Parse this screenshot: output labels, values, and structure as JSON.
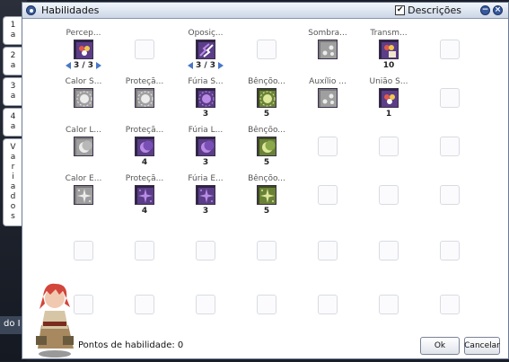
{
  "background_text": "do I",
  "tabs": [
    "1a",
    "2a",
    "3a",
    "4a",
    "Variados"
  ],
  "window": {
    "title": "Habilidades",
    "descriptions_label": "Descrições",
    "descriptions_checked": true
  },
  "colors": {
    "accent": "#355a9e",
    "arrow": "#4a78c8"
  },
  "skills": [
    {
      "row": 0,
      "col": 0,
      "name": "Percep...",
      "level": "3 / 3",
      "arrows": true,
      "icon": "perception-icon",
      "theme": "violet"
    },
    {
      "row": 0,
      "col": 1
    },
    {
      "row": 0,
      "col": 2,
      "name": "Oposiç...",
      "level": "3 / 3",
      "arrows": true,
      "icon": "opposition-icon",
      "theme": "violet"
    },
    {
      "row": 0,
      "col": 3
    },
    {
      "row": 0,
      "col": 4,
      "name": "Sombra...",
      "icon": "shadow-icon",
      "theme": "gray"
    },
    {
      "row": 0,
      "col": 5,
      "name": "Transm...",
      "level": "10",
      "icon": "transmission-icon",
      "theme": "violet"
    },
    {
      "row": 0,
      "col": 6
    },
    {
      "row": 1,
      "col": 0,
      "name": "Calor S...",
      "icon": "sun-heat-icon",
      "theme": "gray"
    },
    {
      "row": 1,
      "col": 1,
      "name": "Proteçã...",
      "icon": "sun-protection-icon",
      "theme": "gray"
    },
    {
      "row": 1,
      "col": 2,
      "name": "Fúria S...",
      "level": "3",
      "icon": "sun-fury-icon",
      "theme": "violet"
    },
    {
      "row": 1,
      "col": 3,
      "name": "Bênçõo...",
      "level": "5",
      "icon": "sun-blessing-icon",
      "theme": "green"
    },
    {
      "row": 1,
      "col": 4,
      "name": "Auxílio ...",
      "icon": "aid-icon",
      "theme": "gray"
    },
    {
      "row": 1,
      "col": 5,
      "name": "União S...",
      "level": "1",
      "icon": "union-icon",
      "theme": "violet"
    },
    {
      "row": 1,
      "col": 6
    },
    {
      "row": 2,
      "col": 0,
      "name": "Calor L...",
      "icon": "moon-heat-icon",
      "theme": "gray"
    },
    {
      "row": 2,
      "col": 1,
      "name": "Proteçã...",
      "level": "4",
      "icon": "moon-protection-icon",
      "theme": "violet"
    },
    {
      "row": 2,
      "col": 2,
      "name": "Fúria L...",
      "level": "3",
      "icon": "moon-fury-icon",
      "theme": "violet"
    },
    {
      "row": 2,
      "col": 3,
      "name": "Bênçõo...",
      "level": "5",
      "icon": "moon-blessing-icon",
      "theme": "green"
    },
    {
      "row": 2,
      "col": 4
    },
    {
      "row": 2,
      "col": 5
    },
    {
      "row": 2,
      "col": 6
    },
    {
      "row": 3,
      "col": 0,
      "name": "Calor E...",
      "icon": "star-heat-icon",
      "theme": "gray"
    },
    {
      "row": 3,
      "col": 1,
      "name": "Proteçã...",
      "level": "4",
      "icon": "star-protection-icon",
      "theme": "violet"
    },
    {
      "row": 3,
      "col": 2,
      "name": "Fúria E...",
      "level": "3",
      "icon": "star-fury-icon",
      "theme": "violet"
    },
    {
      "row": 3,
      "col": 3,
      "name": "Bênçõo...",
      "level": "5",
      "icon": "star-blessing-icon",
      "theme": "green"
    },
    {
      "row": 3,
      "col": 4
    },
    {
      "row": 3,
      "col": 5
    },
    {
      "row": 3,
      "col": 6
    },
    {
      "row": 4,
      "col": 0
    },
    {
      "row": 4,
      "col": 1
    },
    {
      "row": 4,
      "col": 2
    },
    {
      "row": 4,
      "col": 3
    },
    {
      "row": 4,
      "col": 4
    },
    {
      "row": 4,
      "col": 5
    },
    {
      "row": 4,
      "col": 6
    },
    {
      "row": 5,
      "col": 0
    },
    {
      "row": 5,
      "col": 1
    },
    {
      "row": 5,
      "col": 2
    },
    {
      "row": 5,
      "col": 3
    },
    {
      "row": 5,
      "col": 4
    },
    {
      "row": 5,
      "col": 5
    },
    {
      "row": 5,
      "col": 6
    }
  ],
  "footer": {
    "points_label": "Pontos de habilidade: 0",
    "ok_label": "Ok",
    "cancel_label": "Cancelar"
  }
}
